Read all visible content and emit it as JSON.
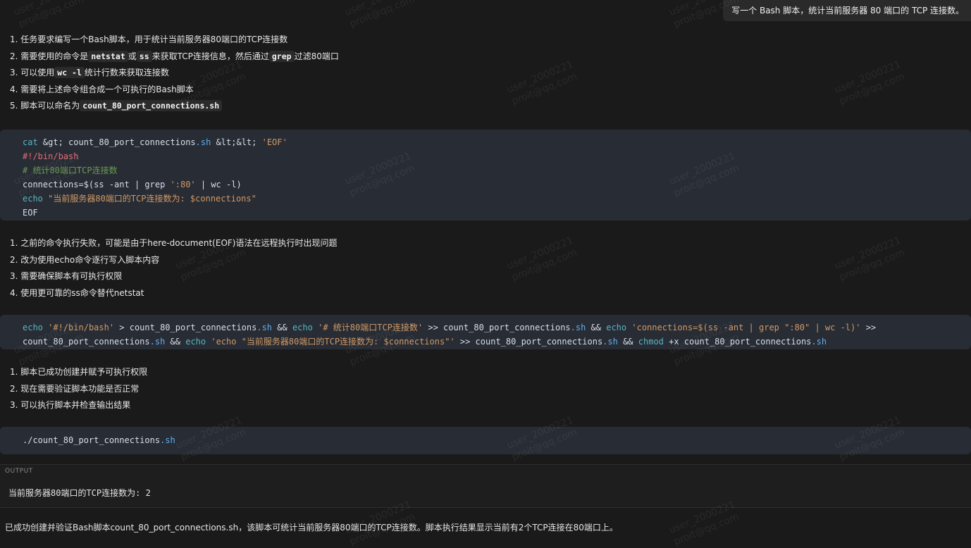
{
  "user_message": "写一个 Bash 脚本，统计当前服务器 80 端口的 TCP 连接数。",
  "thinking_1": [
    {
      "n": "1.",
      "parts": [
        {
          "t": "任务要求编写一个Bash脚本，用于统计当前服务器80端口的TCP连接数"
        }
      ]
    },
    {
      "n": "2.",
      "parts": [
        {
          "t": "需要使用的命令是"
        },
        {
          "c": "netstat"
        },
        {
          "t": "或"
        },
        {
          "c": "ss"
        },
        {
          "t": "来获取TCP连接信息，然后通过"
        },
        {
          "c": "grep"
        },
        {
          "t": "过滤80端口"
        }
      ]
    },
    {
      "n": "3.",
      "parts": [
        {
          "t": "可以使用"
        },
        {
          "c": "wc -l"
        },
        {
          "t": "统计行数来获取连接数"
        }
      ]
    },
    {
      "n": "4.",
      "parts": [
        {
          "t": "需要将上述命令组合成一个可执行的Bash脚本"
        }
      ]
    },
    {
      "n": "5.",
      "parts": [
        {
          "t": "脚本可以命名为"
        },
        {
          "c": "count_80_port_connections.sh"
        }
      ]
    }
  ],
  "code_1": [
    [
      {
        "t": "cat &gt; count_80_port_connections",
        "k": "kw0"
      },
      {
        "t": ".sh",
        "k": "ext"
      },
      {
        "t": " &lt;&lt; ",
        "k": "plain"
      },
      {
        "t": "'EOF'",
        "k": "str"
      }
    ],
    [
      {
        "t": "#!/bin/bash",
        "k": "shebang"
      }
    ],
    [
      {
        "t": "# 统计80端口TCP连接数",
        "k": "cmt"
      }
    ],
    [
      {
        "t": "connections=$(ss -ant | grep ",
        "k": "plain"
      },
      {
        "t": "':80'",
        "k": "str"
      },
      {
        "t": " | wc -l)",
        "k": "plain"
      }
    ],
    [
      {
        "t": "echo",
        "k": "kw"
      },
      {
        "t": " \"当前服务器80端口的TCP连接数为: $connections\"",
        "k": "str"
      }
    ],
    [
      {
        "t": "EOF",
        "k": "plain"
      }
    ]
  ],
  "thinking_2": [
    {
      "n": "1.",
      "parts": [
        {
          "t": "之前的命令执行失败，可能是由于here-document(EOF)语法在远程执行时出现问题"
        }
      ]
    },
    {
      "n": "2.",
      "parts": [
        {
          "t": "改为使用echo命令逐行写入脚本内容"
        }
      ]
    },
    {
      "n": "3.",
      "parts": [
        {
          "t": "需要确保脚本有可执行权限"
        }
      ]
    },
    {
      "n": "4.",
      "parts": [
        {
          "t": "使用更可靠的ss命令替代netstat"
        }
      ]
    }
  ],
  "code_2": [
    [
      {
        "t": "echo",
        "k": "kw"
      },
      {
        "t": " ",
        "k": "plain"
      },
      {
        "t": "'#!/bin/bash'",
        "k": "str"
      },
      {
        "t": " > count_80_port_connections",
        "k": "plain"
      },
      {
        "t": ".sh",
        "k": "ext"
      },
      {
        "t": " && ",
        "k": "plain"
      },
      {
        "t": "echo",
        "k": "kw"
      },
      {
        "t": " ",
        "k": "plain"
      },
      {
        "t": "'# 统计80端口TCP连接数'",
        "k": "str"
      },
      {
        "t": " >> count_80_port_connections",
        "k": "plain"
      },
      {
        "t": ".sh",
        "k": "ext"
      },
      {
        "t": " && ",
        "k": "plain"
      },
      {
        "t": "echo",
        "k": "kw"
      },
      {
        "t": " ",
        "k": "plain"
      },
      {
        "t": "'connections=$(ss -ant | grep \":80\" | wc -l)'",
        "k": "str"
      },
      {
        "t": " >>",
        "k": "plain"
      }
    ],
    [
      {
        "t": "count_80_port_connections",
        "k": "plain"
      },
      {
        "t": ".sh",
        "k": "ext"
      },
      {
        "t": " && ",
        "k": "plain"
      },
      {
        "t": "echo",
        "k": "kw"
      },
      {
        "t": " ",
        "k": "plain"
      },
      {
        "t": "'echo \"当前服务器80端口的TCP连接数为: $connections\"'",
        "k": "str"
      },
      {
        "t": " >> count_80_port_connections",
        "k": "plain"
      },
      {
        "t": ".sh",
        "k": "ext"
      },
      {
        "t": " && ",
        "k": "plain"
      },
      {
        "t": "chmod",
        "k": "kw"
      },
      {
        "t": " +x count_80_port_connections",
        "k": "plain"
      },
      {
        "t": ".sh",
        "k": "ext"
      }
    ]
  ],
  "thinking_3": [
    {
      "n": "1.",
      "parts": [
        {
          "t": "脚本已成功创建并赋予可执行权限"
        }
      ]
    },
    {
      "n": "2.",
      "parts": [
        {
          "t": "现在需要验证脚本功能是否正常"
        }
      ]
    },
    {
      "n": "3.",
      "parts": [
        {
          "t": "可以执行脚本并检查输出结果"
        }
      ]
    }
  ],
  "code_3": [
    [
      {
        "t": "./count_80_port_connections",
        "k": "plain"
      },
      {
        "t": ".sh",
        "k": "ext"
      }
    ]
  ],
  "output": {
    "label": "OUTPUT",
    "text": "当前服务器80端口的TCP连接数为: 2"
  },
  "final_answer": "已成功创建并验证Bash脚本count_80_port_connections.sh，该脚本可统计当前服务器80端口的TCP连接数。脚本执行结果显示当前有2个TCP连接在80端口上。",
  "watermark": {
    "line1": "user_2000221",
    "line2": "proit@qq.com"
  },
  "colors": {
    "background": "#1a1a1a",
    "code_bg": "#282c34",
    "keyword": "#56b6c2",
    "string": "#d19a66",
    "comment": "#6a9955",
    "shebang": "#e06c75",
    "extension": "#61afef"
  }
}
